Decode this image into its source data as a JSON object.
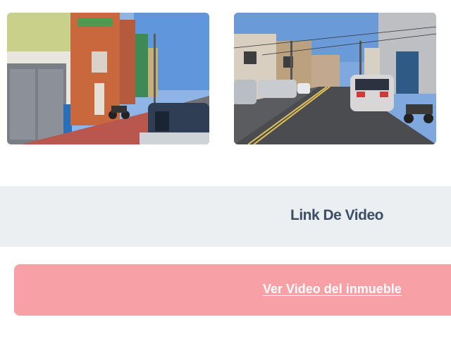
{
  "gallery": {
    "photo_left_desc": "street-facade-photo",
    "photo_right_desc": "street-cars-photo"
  },
  "video_section": {
    "title": "Link De Video",
    "link_label": "Ver Video del inmueble"
  },
  "colors": {
    "band_bg": "#eceff1",
    "title_text": "#3b4e66",
    "button_bg": "#f7a1a6",
    "button_text": "#ffffff"
  }
}
